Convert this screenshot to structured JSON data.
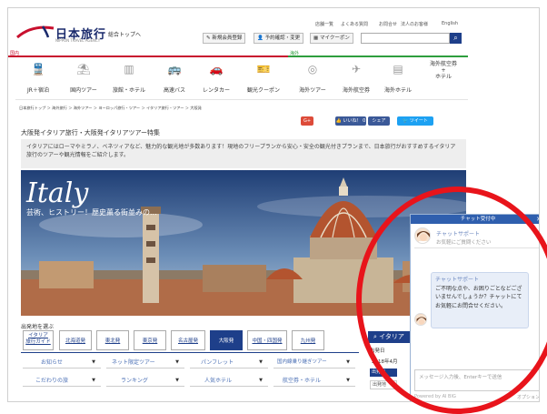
{
  "header": {
    "logo": "日本旅行",
    "logo_sub": "NIPPON TRAVEL AGENCY",
    "top_link": "総合トップへ",
    "utility": [
      "店舗一覧",
      "よくある質問",
      "お問合せ",
      "法人のお客様",
      "English"
    ],
    "register": "新規会員登録",
    "reservation": "予約確認・変更",
    "mycoupon": "マイクーポン",
    "search_icon": "search-icon"
  },
  "sections": {
    "domestic": "国内",
    "overseas": "海外"
  },
  "nav": [
    {
      "label": "JR＋宿泊",
      "icon": "train-icon"
    },
    {
      "label": "国内ツアー",
      "icon": "tour-icon"
    },
    {
      "label": "旅館・ホテル",
      "icon": "hotel-icon"
    },
    {
      "label": "高速バス",
      "icon": "bus-icon"
    },
    {
      "label": "レンタカー",
      "icon": "car-icon"
    },
    {
      "label": "観光クーポン",
      "icon": "ticket-icon"
    },
    {
      "label": "海外ツアー",
      "icon": "globe-icon"
    },
    {
      "label": "海外航空券",
      "icon": "plane-icon"
    },
    {
      "label": "海外ホテル",
      "icon": "building-icon"
    },
    {
      "label": "海外航空券\n+\nホテル",
      "icon": ""
    }
  ],
  "breadcrumb": "日本旅行トップ ＞ 海外旅行 ＞ 海外ツアー ＞ ヨーロッパ旅行・ツアー ＞ イタリア旅行・ツアー ＞ 大阪発",
  "social": {
    "gplus": "G+",
    "like": "いいね！ 0",
    "share": "シェア",
    "tweet": "ツイート"
  },
  "page_title": "大阪発イタリア旅行・大阪発イタリアツアー特集",
  "intro": "イタリアにはローマやミラノ、ベネツィアなど、魅力的な観光地が多数あります！現地のフリープランから安心・安全の観光付きプランまで、日本旅行がおすすめするイタリア旅行のツアーや観光情報をご紹介します。",
  "hero": {
    "title": "Italy",
    "subtitle": "芸術、ヒストリー！歴史薫る街並みの..."
  },
  "departure": {
    "label": "出発地を選ぶ",
    "tabs": [
      "イタリア\n旅行ガイド",
      "北海道発",
      "東北発",
      "東京発",
      "名古屋発",
      "大阪発",
      "中国・四国発",
      "九州発"
    ],
    "active": "大阪発"
  },
  "dropdowns": [
    "お知らせ",
    "ネット限定ツアー",
    "パンフレット",
    "国内線乗り継ぎツアー",
    "こだわりの旅",
    "ランキング",
    "人気ホテル",
    "航空券・ホテル"
  ],
  "sidebar": {
    "title": "イタリア",
    "depart_date": "出発日",
    "year": "2018年4月",
    "tag1": "出発地",
    "tag2": "出発地"
  },
  "chat": {
    "header": "チャット受付中",
    "agent_name": "チャットサポート",
    "greeting": "お気軽にご質問ください",
    "agent_name2": "チャットサポート",
    "message": "ご不明な点や、お困りごとなどございませんでしょうか？チャットにてお気軽にお問合せください。",
    "input_placeholder": "メッセージ入力後、Enterキーで送信",
    "powered": "Powered by AI BIG",
    "options": "オプション"
  },
  "colors": {
    "brand_blue": "#1e3f8a",
    "domestic_red": "#c8102e",
    "overseas_green": "#2e9e3e",
    "highlight_red": "#e8141b"
  }
}
